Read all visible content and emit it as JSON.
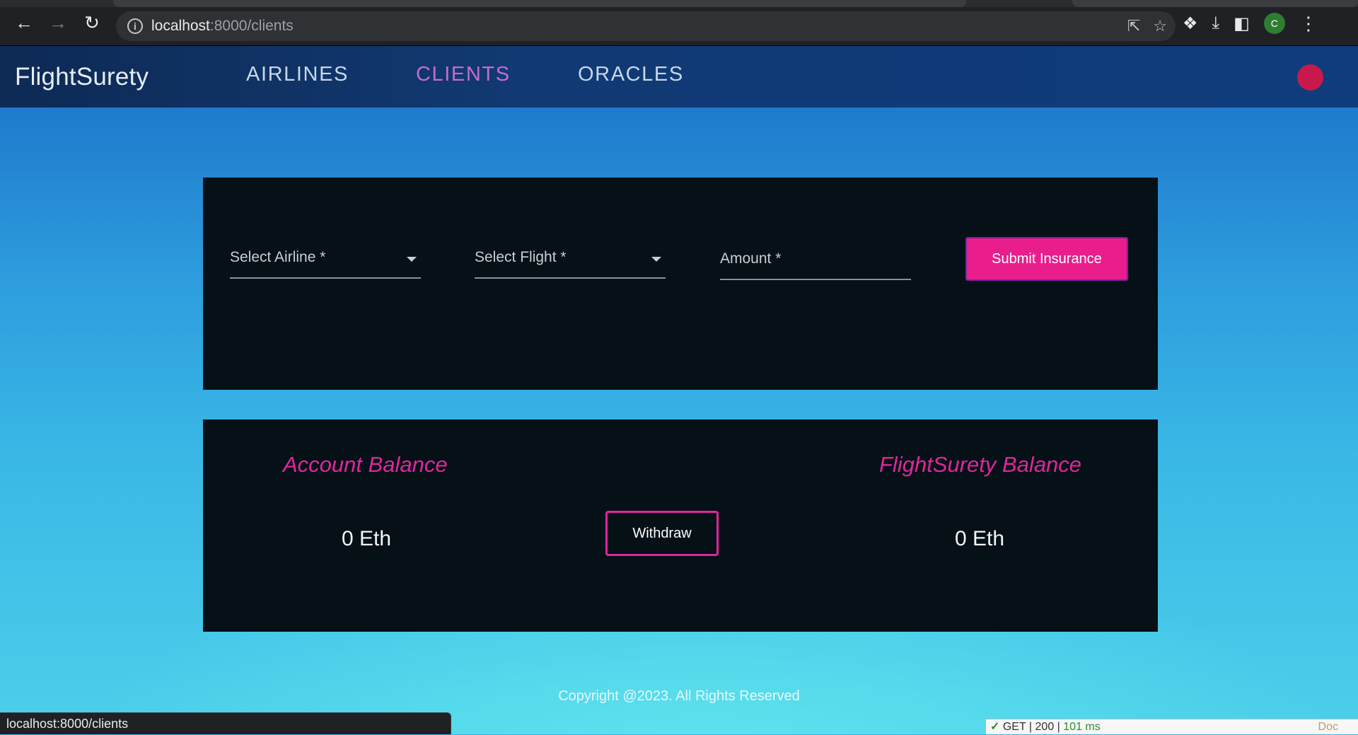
{
  "browser": {
    "back_icon": "arrow-left-icon",
    "forward_icon": "arrow-right-icon",
    "reload_icon": "reload-icon",
    "url_host": "localhost",
    "url_path": ":8000/clients",
    "profile_initial": "C"
  },
  "header": {
    "brand": "FlightSurety",
    "nav": [
      {
        "label": "AIRLINES",
        "active": false
      },
      {
        "label": "CLIENTS",
        "active": true
      },
      {
        "label": "ORACLES",
        "active": false
      }
    ],
    "status_color": "#c8194c"
  },
  "insurance_form": {
    "airline_label": "Select Airline *",
    "flight_label": "Select Flight *",
    "amount_label": "Amount *",
    "submit_label": "Submit Insurance"
  },
  "balances": {
    "account_title": "Account Balance",
    "account_value": "0 Eth",
    "withdraw_label": "Withdraw",
    "surety_title": "FlightSurety Balance",
    "surety_value": "0 Eth"
  },
  "footer": {
    "copyright": "Copyright @2023. All Rights Reserved"
  },
  "status_bar": {
    "hover_url": "localhost:8000/clients"
  },
  "debug_bar": {
    "check": "✓",
    "method": "GET",
    "status": "200",
    "time": "101 ms",
    "doc": "Doc"
  },
  "colors": {
    "accent_pink": "#e91e8c",
    "active_nav": "#c56bd0",
    "panel_bg": "#051017"
  }
}
